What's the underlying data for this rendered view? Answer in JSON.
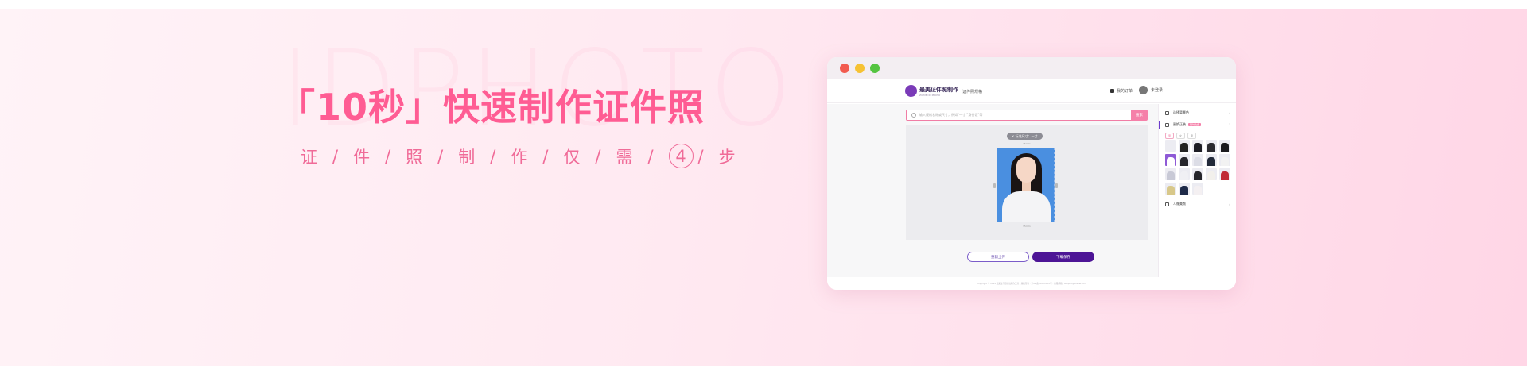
{
  "hero": {
    "watermark": "IDPHOTO",
    "headline": "「10秒」快速制作证件照",
    "steps": [
      "证",
      "/",
      "件",
      "/",
      "照",
      "/",
      "制",
      "/",
      "作",
      "/",
      "仅",
      "/",
      "需",
      "/"
    ],
    "step_count": "4",
    "step_suffix": [
      "/",
      "步"
    ]
  },
  "app": {
    "brand": "最美证件照制作",
    "brand_sub": "ZUIMEI ID PHOTO",
    "nav_link": "证件照规格",
    "orders": "我的订单",
    "user": "未登录",
    "search_placeholder": "输入规格名称或尺寸，例如\"一寸\"\"身份证\"等",
    "search_button": "搜索",
    "size_tag": "× 标准尺寸：一寸",
    "dim_top": "25mm",
    "dim_bottom": "35mm",
    "upload_button": "重新上传",
    "download_button": "下载保存",
    "panel": {
      "item1": "选择背景色",
      "item2": "更换正装",
      "item2_badge": "限时免费",
      "chip1": "男",
      "chip2": "女",
      "chip3": "童",
      "item3": "人像美颜"
    },
    "footer": "Copyright © 2024 最美证件照在线制作工具 · 版权所有 · 京ICP备XXXXXXXX号 · 客服邮箱：support@zuimei.com"
  },
  "colors": {
    "accent": "#ff5c93",
    "brand_purple": "#4d1596",
    "photo_bg": "#4a8fe0"
  }
}
